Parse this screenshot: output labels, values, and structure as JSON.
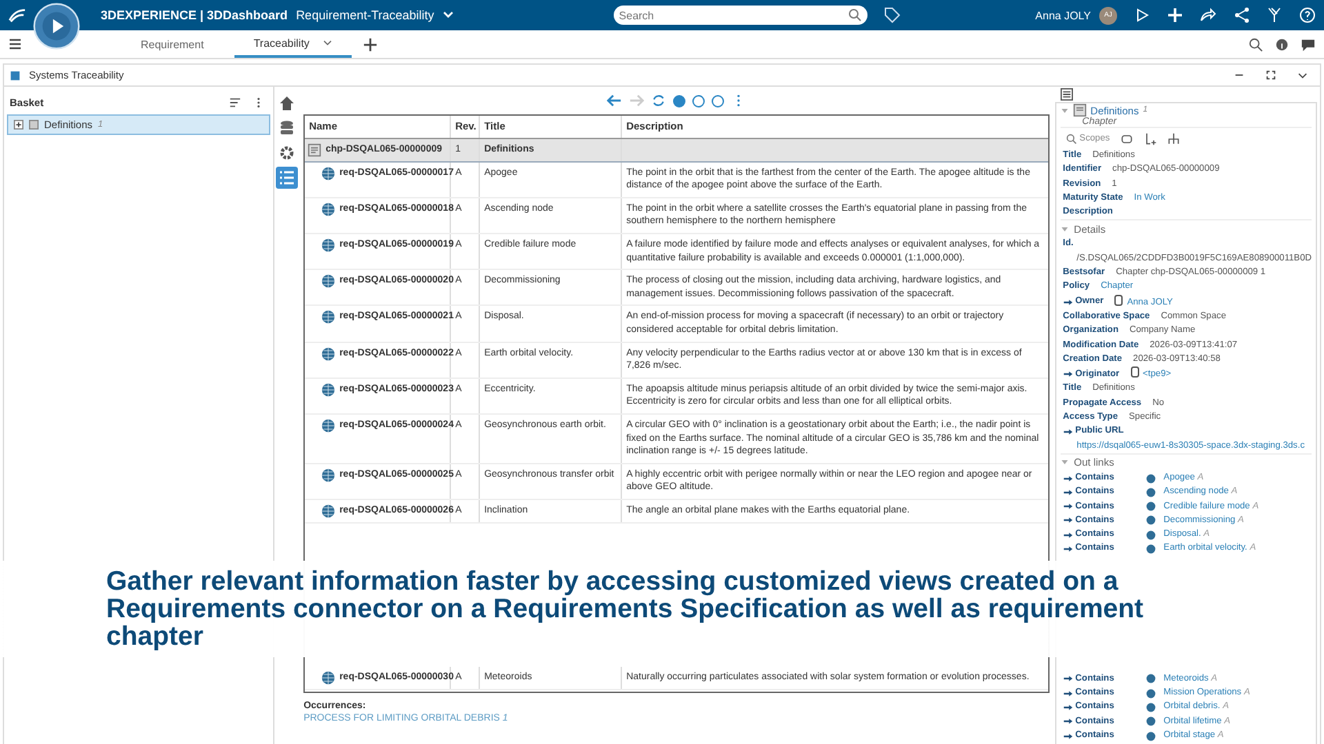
{
  "top_bar": {
    "brand": "3DEXPERIENCE | 3DDashboard",
    "dashboard": "Requirement-Traceability",
    "search": {
      "placeholder": "Search"
    },
    "user": "Anna JOLY",
    "avatar": "AJ"
  },
  "tabs": [
    {
      "label": "Requirement",
      "selected": false
    },
    {
      "label": "Traceability",
      "selected": true
    }
  ],
  "window": {
    "title": "Systems Traceability"
  },
  "basket": {
    "title": "Basket",
    "items": [
      {
        "label": "Definitions",
        "count": "1",
        "selected": true
      }
    ]
  },
  "side_tools": [
    {
      "kind": "home",
      "selected": false
    },
    {
      "kind": "database",
      "selected": false
    },
    {
      "kind": "settings",
      "selected": false
    },
    {
      "kind": "list",
      "selected": true
    }
  ],
  "views": [
    {
      "selected": true
    },
    {
      "selected": false
    },
    {
      "selected": false
    }
  ],
  "table": {
    "columns": [
      "Name",
      "Rev.",
      "Title",
      "Description"
    ],
    "chapter": {
      "name": "chp-DSQAL065-00000009",
      "rev": "1",
      "title": "Definitions"
    },
    "rows": [
      {
        "name": "req-DSQAL065-00000017",
        "rev": "A",
        "title": "Apogee",
        "description": "The point in the orbit that is the farthest from the center of the Earth. The apogee altitude is the distance of the apogee point above the surface of the Earth."
      },
      {
        "name": "req-DSQAL065-00000018",
        "rev": "A",
        "title": "Ascending node",
        "description": "The point in the orbit where a satellite crosses the Earth's equatorial plane in passing from the southern hemisphere to the northern hemisphere"
      },
      {
        "name": "req-DSQAL065-00000019",
        "rev": "A",
        "title": "Credible failure mode",
        "description": "A failure mode identified by failure mode and effects analyses or equivalent analyses, for which a quantitative failure probability is available and exceeds 0.000001 (1:1,000,000)."
      },
      {
        "name": "req-DSQAL065-00000020",
        "rev": "A",
        "title": "Decommissioning",
        "description": "The process of closing out the mission, including data archiving, hardware logistics, and management issues. Decommissioning follows passivation of the spacecraft."
      },
      {
        "name": "req-DSQAL065-00000021",
        "rev": "A",
        "title": "Disposal.",
        "description": "An end-of-mission process for moving a spacecraft (if necessary) to an orbit or trajectory considered acceptable for orbital debris limitation."
      },
      {
        "name": "req-DSQAL065-00000022",
        "rev": "A",
        "title": "Earth orbital velocity.",
        "description": "Any velocity perpendicular to the Earths radius vector at or above 130 km that is in excess of 7,826 m/sec."
      },
      {
        "name": "req-DSQAL065-00000023",
        "rev": "A",
        "title": "Eccentricity.",
        "description": "The apoapsis altitude minus periapsis altitude of an orbit divided by twice the semi-major axis. Eccentricity is zero for circular orbits and less than one for all elliptical orbits."
      },
      {
        "name": "req-DSQAL065-00000024",
        "rev": "A",
        "title": "Geosynchronous earth orbit.",
        "description": "A circular GEO with 0° inclination is a geostationary orbit about the Earth; i.e., the nadir point is fixed on the Earths surface. The nominal altitude of a circular GEO is 35,786 km and the nominal inclination range is +/- 15 degrees latitude."
      },
      {
        "name": "req-DSQAL065-00000025",
        "rev": "A",
        "title": "Geosynchronous transfer orbit",
        "description": "A highly eccentric orbit with perigee normally within or near the LEO region and apogee near or above GEO altitude."
      },
      {
        "name": "req-DSQAL065-00000026",
        "rev": "A",
        "title": "Inclination",
        "description": "The angle an orbital plane makes with the Earths equatorial plane."
      }
    ],
    "rows_after": [
      {
        "name": "req-DSQAL065-00000030",
        "rev": "A",
        "title": "Meteoroids",
        "description": "Naturally occurring particulates associated with solar system formation or evolution processes."
      }
    ]
  },
  "occurrences": {
    "label": "Occurrences:",
    "items": [
      {
        "title": "PROCESS FOR LIMITING ORBITAL DEBRIS",
        "rev": "1"
      }
    ]
  },
  "properties": {
    "title": "Definitions",
    "count": "1",
    "type": "Chapter",
    "scopes": "Scopes",
    "fields": [
      {
        "label": "Title",
        "value": "Definitions",
        "kind": "text",
        "arrow": false,
        "below": false
      },
      {
        "label": "Identifier",
        "value": "chp-DSQAL065-00000009",
        "kind": "text",
        "arrow": false,
        "below": false
      },
      {
        "label": "Revision",
        "value": "1",
        "kind": "text",
        "arrow": false,
        "below": false
      },
      {
        "label": "Maturity State",
        "value": "In Work",
        "kind": "link",
        "arrow": false,
        "below": false
      },
      {
        "label": "Description",
        "kind": "text",
        "arrow": false,
        "below": false
      }
    ],
    "details_title": "Details",
    "details": [
      {
        "label": "Id.",
        "value": "/S.DSQAL065/2CDDFD3B0019F5C169AE808900011B0D",
        "kind": "text",
        "arrow": false,
        "below": true
      },
      {
        "label": "Bestsofar",
        "value": "Chapter chp-DSQAL065-00000009 1",
        "kind": "text",
        "arrow": false,
        "below": false
      },
      {
        "label": "Policy",
        "value": "Chapter",
        "kind": "link",
        "arrow": false,
        "below": false
      },
      {
        "label": "Owner",
        "value": "Anna JOLY",
        "kind": "user",
        "arrow": true,
        "below": false
      },
      {
        "label": "Collaborative Space",
        "value": "Common Space",
        "kind": "text",
        "arrow": false,
        "below": false
      },
      {
        "label": "Organization",
        "value": "Company Name",
        "kind": "text",
        "arrow": false,
        "below": false
      },
      {
        "label": "Modification Date",
        "value": "2026-03-09T13:41:07",
        "kind": "text",
        "arrow": false,
        "below": false
      },
      {
        "label": "Creation Date",
        "value": "2026-03-09T13:40:58",
        "kind": "text",
        "arrow": false,
        "below": false
      },
      {
        "label": "Originator",
        "value": "<tpe9>",
        "kind": "user",
        "arrow": true,
        "below": false
      },
      {
        "label": "Title",
        "value": "Definitions",
        "kind": "text",
        "arrow": false,
        "below": false
      },
      {
        "label": "Propagate Access",
        "value": "No",
        "kind": "text",
        "arrow": false,
        "below": false
      },
      {
        "label": "Access Type",
        "value": "Specific",
        "kind": "text",
        "arrow": false,
        "below": false
      },
      {
        "label": "Public URL",
        "value": "https://dsqal065-euw1-8s30305-space.3dx-staging.3ds.c",
        "kind": "link",
        "arrow": true,
        "below": true
      }
    ],
    "outlinks_title": "Out links",
    "outlinks": [
      {
        "relation": "Contains",
        "title": "Apogee",
        "rev": "A"
      },
      {
        "relation": "Contains",
        "title": "Ascending node",
        "rev": "A"
      },
      {
        "relation": "Contains",
        "title": "Credible failure mode",
        "rev": "A"
      },
      {
        "relation": "Contains",
        "title": "Decommissioning",
        "rev": "A"
      },
      {
        "relation": "Contains",
        "title": "Disposal.",
        "rev": "A"
      },
      {
        "relation": "Contains",
        "title": "Earth orbital velocity.",
        "rev": "A"
      }
    ],
    "outlinks_after": [
      {
        "relation": "Contains",
        "title": "Meteoroids",
        "rev": "A"
      },
      {
        "relation": "Contains",
        "title": "Mission Operations",
        "rev": "A"
      },
      {
        "relation": "Contains",
        "title": "Orbital debris.",
        "rev": "A"
      },
      {
        "relation": "Contains",
        "title": "Orbital lifetime",
        "rev": "A"
      },
      {
        "relation": "Contains",
        "title": "Orbital stage",
        "rev": "A"
      }
    ]
  },
  "caption": "Gather relevant information faster by accessing customized views created on a Requirements connector on a Requirements Specification as well as requirement chapter"
}
